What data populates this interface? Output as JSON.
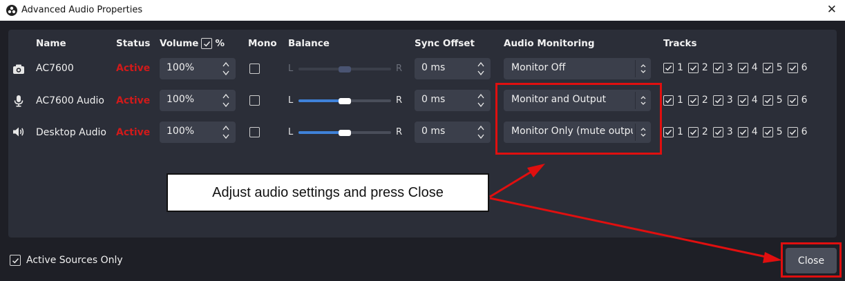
{
  "window": {
    "title": "Advanced Audio Properties"
  },
  "headers": {
    "name": "Name",
    "status": "Status",
    "volume": "Volume",
    "percent_label": "%",
    "mono": "Mono",
    "balance": "Balance",
    "sync_offset": "Sync Offset",
    "audio_monitoring": "Audio Monitoring",
    "tracks": "Tracks"
  },
  "balance_labels": {
    "left": "L",
    "right": "R"
  },
  "sources": [
    {
      "icon": "camera-icon",
      "name": "AC7600",
      "status": "Active",
      "volume": "100%",
      "mono": false,
      "balance_enabled": false,
      "sync_offset": "0 ms",
      "monitoring": "Monitor Off",
      "tracks": [
        "1",
        "2",
        "3",
        "4",
        "5",
        "6"
      ]
    },
    {
      "icon": "microphone-icon",
      "name": "AC7600 Audio",
      "status": "Active",
      "volume": "100%",
      "mono": false,
      "balance_enabled": true,
      "sync_offset": "0 ms",
      "monitoring": "Monitor and Output",
      "tracks": [
        "1",
        "2",
        "3",
        "4",
        "5",
        "6"
      ]
    },
    {
      "icon": "speaker-icon",
      "name": "Desktop Audio",
      "status": "Active",
      "volume": "100%",
      "mono": false,
      "balance_enabled": true,
      "sync_offset": "0 ms",
      "monitoring": "Monitor Only (mute output)",
      "tracks": [
        "1",
        "2",
        "3",
        "4",
        "5",
        "6"
      ]
    }
  ],
  "footer": {
    "active_sources_only": "Active Sources Only",
    "close": "Close"
  },
  "annotation": {
    "text": "Adjust audio settings and press Close"
  },
  "colors": {
    "status_active": "#d11a1a",
    "slider_fill": "#3f82d9",
    "highlight": "#e00f0f",
    "background": "#1e1f26",
    "panel": "#2b2e38"
  }
}
